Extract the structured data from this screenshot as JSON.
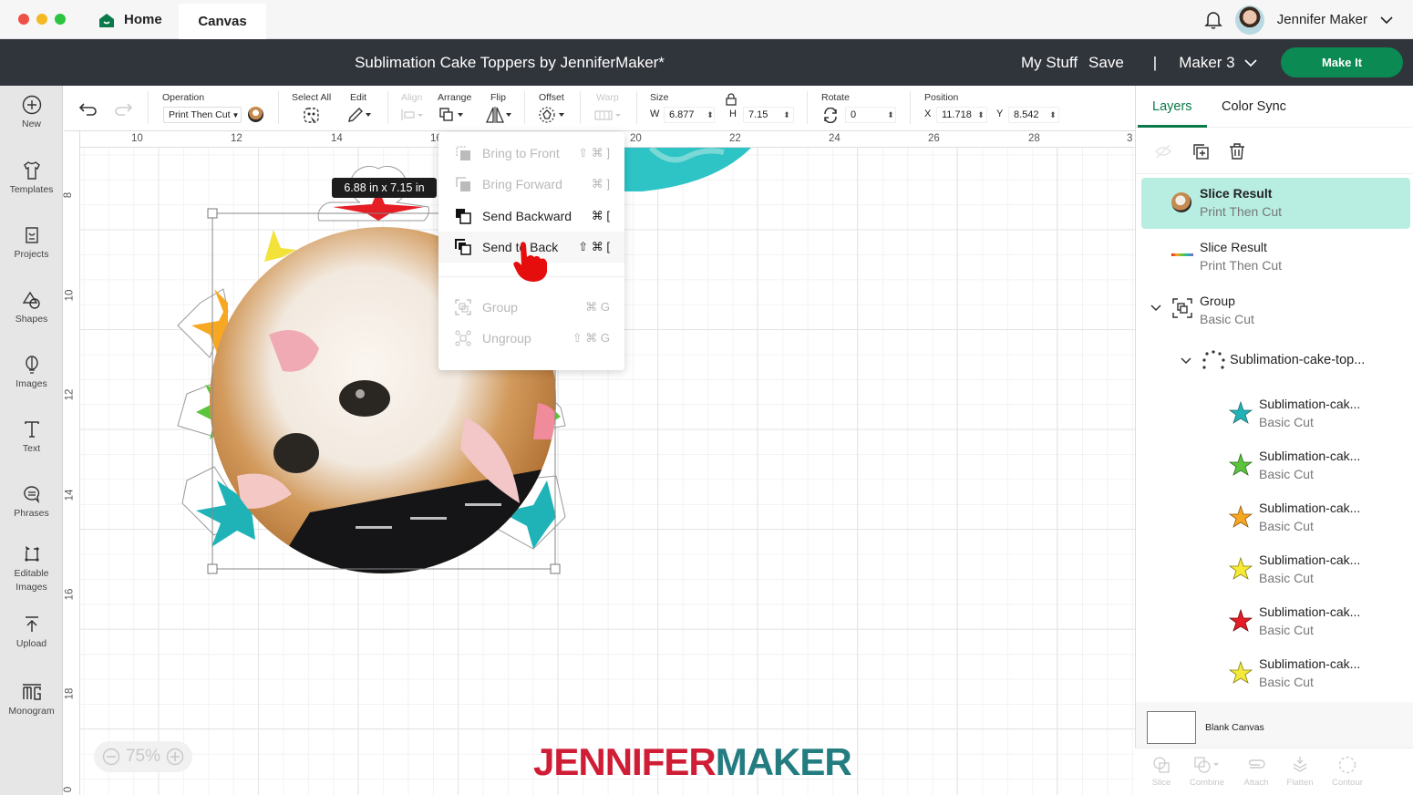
{
  "window": {
    "traffic_lights": [
      "#ee4f46",
      "#f4b824",
      "#2cc340"
    ],
    "tabs": [
      {
        "label": "Home",
        "icon": "home-icon"
      },
      {
        "label": "Canvas",
        "active": true
      }
    ],
    "user_name": "Jennifer Maker"
  },
  "header": {
    "title": "Sublimation Cake Toppers by JenniferMaker*",
    "my_stuff": "My Stuff",
    "save": "Save",
    "divider": "|",
    "machine": "Maker 3",
    "make_it": "Make It",
    "accent": "#0b8a53"
  },
  "sidebar": {
    "items": [
      {
        "label": "New",
        "icon": "plus-circle-icon"
      },
      {
        "label": "Templates",
        "icon": "tshirt-icon"
      },
      {
        "label": "Projects",
        "icon": "project-card-icon"
      },
      {
        "label": "Shapes",
        "icon": "shapes-icon"
      },
      {
        "label": "Images",
        "icon": "lightbulb-icon"
      },
      {
        "label": "Text",
        "icon": "text-icon"
      },
      {
        "label": "Phrases",
        "icon": "speech-bubble-icon"
      },
      {
        "label": "Editable Images",
        "icon": "editable-images-icon"
      },
      {
        "label": "Upload",
        "icon": "upload-icon"
      },
      {
        "label": "Monogram",
        "icon": "monogram-icon"
      }
    ]
  },
  "toolbar": {
    "operation_label": "Operation",
    "operation_value": "Print Then Cut",
    "select_all": "Select All",
    "edit": "Edit",
    "align": "Align",
    "arrange": "Arrange",
    "flip": "Flip",
    "offset": "Offset",
    "warp": "Warp",
    "size_label": "Size",
    "w_label": "W",
    "w_value": "6.877",
    "h_label": "H",
    "h_value": "7.15",
    "rotate_label": "Rotate",
    "rotate_value": "0",
    "position_label": "Position",
    "x_label": "X",
    "x_value": "11.718",
    "y_label": "Y",
    "y_value": "8.542"
  },
  "rulers": {
    "top": [
      "10",
      "12",
      "14",
      "16",
      "20",
      "22",
      "24",
      "26",
      "28",
      "3"
    ],
    "left": [
      "8",
      "10",
      "12",
      "14",
      "16",
      "18",
      "0"
    ]
  },
  "canvas": {
    "dimension_badge": "6.88  in x 7.15  in",
    "zoom": "75%",
    "watermark_left": "JENNIFER",
    "watermark_right": "MAKER"
  },
  "arrange_menu": {
    "items": [
      {
        "label": "Bring to Front",
        "shortcut": "⇧ ⌘ ]",
        "enabled": false
      },
      {
        "label": "Bring Forward",
        "shortcut": "⌘ ]",
        "enabled": false
      },
      {
        "label": "Send Backward",
        "shortcut": "⌘ [",
        "enabled": true
      },
      {
        "label": "Send to Back",
        "shortcut": "⇧ ⌘ [",
        "enabled": true,
        "hovered": true
      },
      {
        "label": "Group",
        "shortcut": "⌘ G",
        "enabled": false
      },
      {
        "label": "Ungroup",
        "shortcut": "⇧ ⌘ G",
        "enabled": false
      }
    ]
  },
  "layers_panel": {
    "tabs": [
      "Layers",
      "Color Sync"
    ],
    "rows": [
      {
        "name": "Slice Result",
        "op": "Print Then Cut",
        "selected": true,
        "thumb": "cat-photo"
      },
      {
        "name": "Slice Result",
        "op": "Print Then Cut",
        "thumb": "color-strip"
      },
      {
        "name": "Group",
        "op": "Basic Cut",
        "thumb": "group-icon"
      },
      {
        "name": "Sublimation-cake-top...",
        "thumb": "dotted-ring"
      },
      {
        "name": "Sublimation-cak...",
        "op": "Basic Cut",
        "color": "#1fb3b8"
      },
      {
        "name": "Sublimation-cak...",
        "op": "Basic Cut",
        "color": "#5cc43c"
      },
      {
        "name": "Sublimation-cak...",
        "op": "Basic Cut",
        "color": "#f7a823"
      },
      {
        "name": "Sublimation-cak...",
        "op": "Basic Cut",
        "color": "#f7ea35"
      },
      {
        "name": "Sublimation-cak...",
        "op": "Basic Cut",
        "color": "#e51d25"
      },
      {
        "name": "Sublimation-cak...",
        "op": "Basic Cut",
        "color": "#f3e93a"
      }
    ],
    "blank_canvas": "Blank Canvas",
    "bottom_actions": [
      "Slice",
      "Combine",
      "Attach",
      "Flatten",
      "Contour"
    ]
  }
}
